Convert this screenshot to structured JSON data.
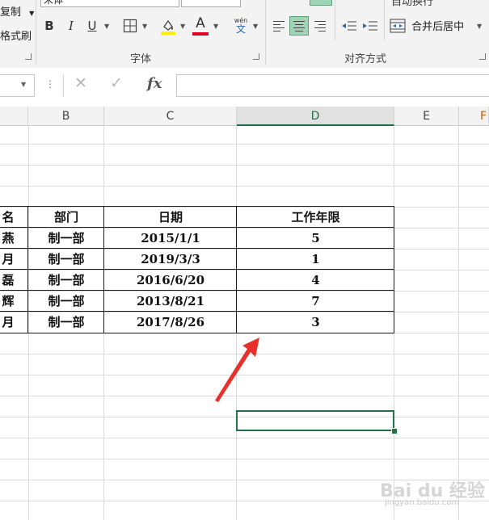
{
  "ribbon": {
    "clipboard": {
      "copy_label": "复制",
      "format_painter_label": "格式刷"
    },
    "font": {
      "group_label": "字体",
      "font_name": "宋体",
      "bold": "B",
      "italic": "I",
      "underline": "U",
      "font_color_glyph": "A",
      "pinyin_top": "wén",
      "pinyin_bottom": "文",
      "fill_color": "#ffee00",
      "font_color": "#e0001b"
    },
    "alignment": {
      "group_label": "对齐方式",
      "merge_label": "合并后居中",
      "wrap_label": "自动换行"
    }
  },
  "formula_bar": {
    "fx_label": "fx",
    "cancel_glyph": "✕",
    "enter_glyph": "✓",
    "value": ""
  },
  "columns": [
    "B",
    "C",
    "D",
    "E",
    "F"
  ],
  "selected_column": "D",
  "table": {
    "headers": [
      "名",
      "部门",
      "日期",
      "工作年限"
    ],
    "rows": [
      [
        "燕",
        "制一部",
        "2015/1/1",
        "5"
      ],
      [
        "月",
        "制一部",
        "2019/3/3",
        "1"
      ],
      [
        "磊",
        "制一部",
        "2016/6/20",
        "4"
      ],
      [
        "辉",
        "制一部",
        "2013/8/21",
        "7"
      ],
      [
        "月",
        "制一部",
        "2017/8/26",
        "3"
      ]
    ]
  },
  "arrow_color": "#e8302a",
  "accent_color": "#217346",
  "watermark": {
    "text": "Bai du 经验",
    "sub": "jingyan.baidu.com"
  }
}
